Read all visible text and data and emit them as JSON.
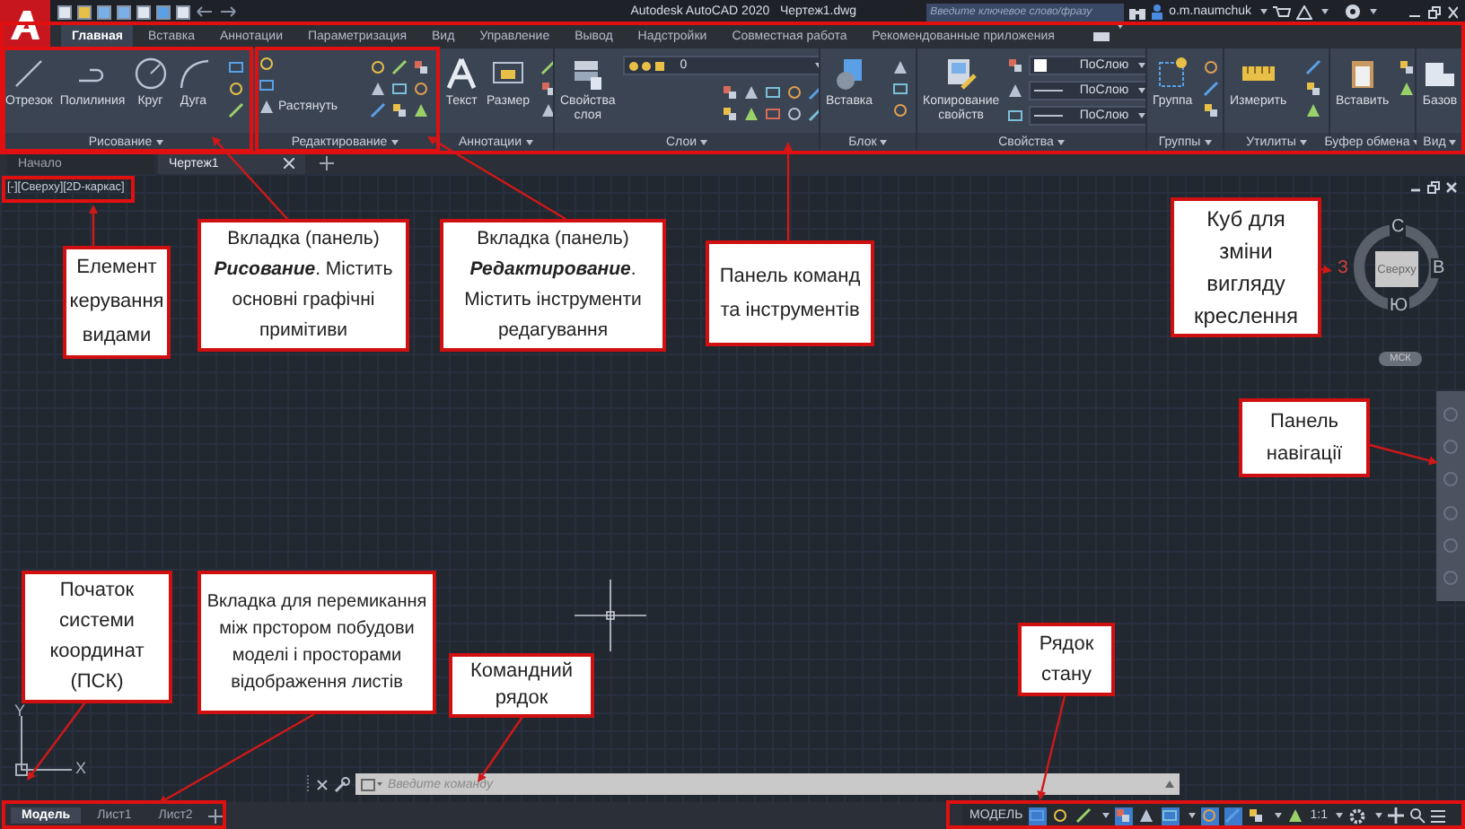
{
  "title_bar": {
    "title": "Autodesk AutoCAD 2020",
    "document": "Чертеж1.dwg",
    "search": {
      "placeholder": "Введите ключевое слово/фразу"
    },
    "user": "o.m.naumchuk"
  },
  "ribbon_tabs": [
    {
      "label": "Главная",
      "selected": true
    },
    {
      "label": "Вставка",
      "selected": false
    },
    {
      "label": "Аннотации",
      "selected": false
    },
    {
      "label": "Параметризация",
      "selected": false
    },
    {
      "label": "Вид",
      "selected": false
    },
    {
      "label": "Управление",
      "selected": false
    },
    {
      "label": "Вывод",
      "selected": false
    },
    {
      "label": "Надстройки",
      "selected": false
    },
    {
      "label": "Совместная работа",
      "selected": false
    },
    {
      "label": "Рекомендованные приложения",
      "selected": false
    }
  ],
  "ribbon_panels": [
    {
      "title": "Рисование",
      "tools": [
        {
          "kind": "large",
          "label": "Отрезок"
        },
        {
          "kind": "large",
          "label": "Полилиния"
        },
        {
          "kind": "large",
          "label": "Круг"
        },
        {
          "kind": "large",
          "label": "Дуга"
        }
      ]
    },
    {
      "title": "Редактирование",
      "tools": [
        {
          "kind": "small",
          "label": "Растянуть"
        }
      ]
    },
    {
      "title": "Аннотации",
      "tools": [
        {
          "kind": "large",
          "label": "Текст"
        },
        {
          "kind": "large",
          "label": "Размер"
        }
      ]
    },
    {
      "title": "Слои",
      "tools": [
        {
          "kind": "large",
          "label": "Свойства слоя"
        },
        {
          "kind": "select",
          "value": "0"
        }
      ]
    },
    {
      "title": "Блок",
      "tools": [
        {
          "kind": "large",
          "label": "Вставка"
        }
      ]
    },
    {
      "title": "Свойства",
      "tools": [
        {
          "kind": "large",
          "label": "Копирование свойств"
        },
        {
          "kind": "select",
          "value": "ПоСлою"
        },
        {
          "kind": "select",
          "value": "ПоСлою"
        },
        {
          "kind": "select",
          "value": "ПоСлою"
        }
      ]
    },
    {
      "title": "Группы",
      "tools": [
        {
          "kind": "large",
          "label": "Группа"
        }
      ]
    },
    {
      "title": "Утилиты",
      "tools": [
        {
          "kind": "large",
          "label": "Измерить"
        }
      ]
    },
    {
      "title": "Буфер обмена",
      "tools": [
        {
          "kind": "large",
          "label": "Вставить"
        }
      ]
    },
    {
      "title": "Вид",
      "tools": [
        {
          "kind": "large",
          "label": "Базов"
        }
      ]
    }
  ],
  "file_tabs": [
    {
      "label": "Начало",
      "selected": false
    },
    {
      "label": "Чертеж1",
      "selected": true
    }
  ],
  "viewport_controls": "[-][Сверху][2D-каркас]",
  "viewcube": {
    "north": "С",
    "west": "З",
    "east": "В",
    "south": "Ю",
    "face": "Сверху",
    "ucs": "МСК"
  },
  "ucs_icon": {
    "x_label": "X",
    "y_label": "Y"
  },
  "command_line": {
    "placeholder": "Введите команду"
  },
  "layout_tabs": [
    {
      "label": "Модель",
      "selected": true
    },
    {
      "label": "Лист1",
      "selected": false
    },
    {
      "label": "Лист2",
      "selected": false
    }
  ],
  "status_bar": {
    "mode": "МОДЕЛЬ",
    "toggles": [
      {
        "on": true
      },
      {
        "on": false
      },
      {
        "on": false
      },
      {
        "on": true
      },
      {
        "on": false
      },
      {
        "on": true
      },
      {
        "on": true
      },
      {
        "on": true
      },
      {
        "on": false
      },
      {
        "on": false
      }
    ],
    "scale": "1:1"
  },
  "annotations": [
    {
      "text": "Елемент керування видами"
    },
    {
      "text": "Вкладка (панель) **Рисование**. Містить основні графічні примітиви"
    },
    {
      "text": "Вкладка (панель) **Редактирование**. Містить інструменти редагування"
    },
    {
      "text": "Панель команд та інструментів"
    },
    {
      "text": "Куб для зміни вигляду креслення"
    },
    {
      "text": "Панель навігації"
    },
    {
      "text": "Початок системи координат (ПСК)"
    },
    {
      "text": "Вкладка для перемикання між прстором побудови моделі і просторами відображення листів"
    },
    {
      "text": "Командний рядок"
    },
    {
      "text": "Рядок стану"
    }
  ]
}
